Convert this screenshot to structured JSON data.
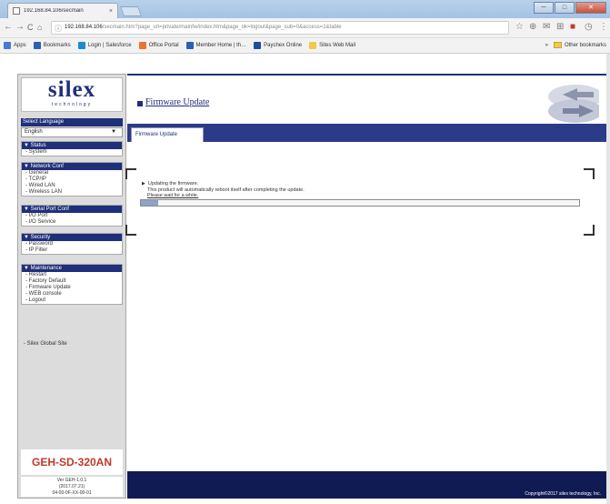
{
  "browser": {
    "tab_title": "192.168.84.106/secmain",
    "tab_close": "×",
    "window_controls": {
      "minimize": "─",
      "maximize": "□",
      "close": "✕"
    },
    "nav": {
      "back": "←",
      "forward": "→",
      "reload": "C",
      "home": "⌂"
    },
    "url_host": "192.168.84.106",
    "url_path": "/secmain.htm?page_url=private/mainfw/index.htm&page_ok=logout&page_sub=0&access=1&table",
    "bookmarks": [
      {
        "label": "Apps",
        "color": "#4a79d1"
      },
      {
        "label": "Bookmarks",
        "color": "#2d5fb3"
      },
      {
        "label": "Login | Salesforce",
        "color": "#1a8ad4"
      },
      {
        "label": "Office Portal",
        "color": "#e8762d"
      },
      {
        "label": "Member Home | th…",
        "color": "#2d5fb3"
      },
      {
        "label": "Paychex Online",
        "color": "#1f4ea0"
      },
      {
        "label": "Sites Web Mail",
        "color": "#f2c94c"
      }
    ],
    "other_bookmarks": "Other bookmarks",
    "bookmarks_more": "»"
  },
  "sidebar": {
    "logo_text": "silex",
    "logo_subtext": "technology",
    "language_label": "Select Language",
    "language_value": "English",
    "language_arrow": "▼",
    "sections": [
      {
        "title": "▼ Status",
        "items": [
          "- System"
        ]
      },
      {
        "title": "▼ Network Conf",
        "items": [
          "- General",
          "- TCP/IP",
          "- Wired LAN",
          "- Wireless LAN"
        ]
      },
      {
        "title": "▼ Serial Port Conf",
        "items": [
          "- I/O Port",
          "- I/O Service"
        ]
      },
      {
        "title": "▼ Security",
        "items": [
          "- Password",
          "- IP Filter"
        ]
      },
      {
        "title": "▼ Maintenance",
        "items": [
          "- Restart",
          "- Factory Default",
          "- Firmware Update",
          "- WEB console",
          "- Logout"
        ]
      }
    ],
    "global_site_link": "- Silex Global Site",
    "model": "GEH-SD-320AN",
    "version_lines": [
      "Ver GEH-1.0.1",
      "(2017.07.21)",
      "04-00-0F-XX-00-01"
    ]
  },
  "main": {
    "page_title": "Firmware Update",
    "tab_label": "Firmware Update",
    "message_line1": "Updating the firmware.",
    "message_line2": "This product will automatically reboot itself after completing the update.",
    "message_line3": "Please wait for a while.",
    "message_marker": "▶",
    "progress_fraction": 0.04,
    "copyright": "Copyright©2017 silex technology, Inc."
  }
}
